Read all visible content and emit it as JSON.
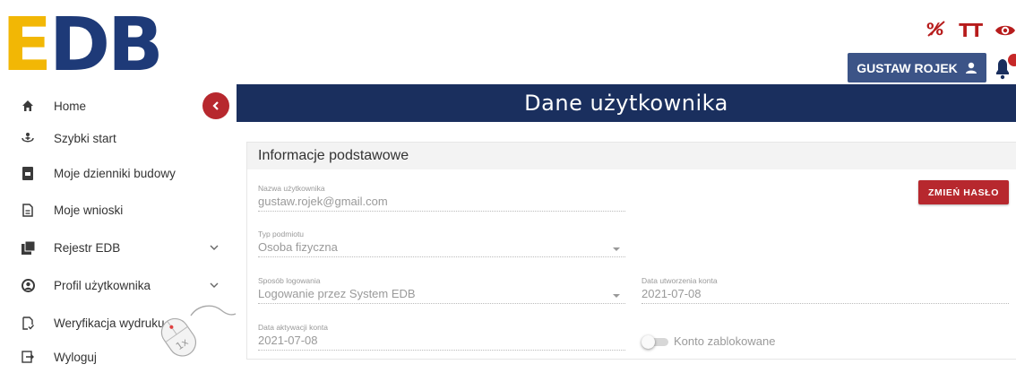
{
  "header": {
    "logo": {
      "e": "E",
      "db": "DB"
    },
    "tools": {
      "contrast_icon": "percent-slash-icon",
      "font_size_label": "TT",
      "eye_icon": "eye-icon"
    },
    "user_button_label": "GUSTAW ROJEK",
    "bell_badge_color": "#c62828"
  },
  "sidebar": {
    "items": [
      {
        "label": "Home",
        "icon": "home-icon"
      },
      {
        "label": "Szybki start",
        "icon": "quick-start-icon"
      },
      {
        "label": "Moje dzienniki budowy",
        "icon": "book-icon"
      },
      {
        "label": "Moje wnioski",
        "icon": "document-icon"
      },
      {
        "label": "Rejestr EDB",
        "icon": "register-icon"
      },
      {
        "label": "Profil użytkownika",
        "icon": "user-circle-icon"
      },
      {
        "label": "Weryfikacja wydruku",
        "icon": "file-check-icon"
      },
      {
        "label": "Wyloguj",
        "icon": "logout-icon"
      }
    ]
  },
  "main": {
    "title": "Dane użytkownika",
    "panel_title": "Informacje podstawowe",
    "fields": {
      "username": {
        "label": "Nazwa użytkownika",
        "value": "gustaw.rojek@gmail.com"
      },
      "entity_type": {
        "label": "Typ podmiotu",
        "value": "Osoba fizyczna"
      },
      "login_method": {
        "label": "Sposób logowania",
        "value": "Logowanie przez System EDB"
      },
      "created_date": {
        "label": "Data utworzenia konta",
        "value": "2021-07-08"
      },
      "activated_date": {
        "label": "Data aktywacji konta",
        "value": "2021-07-08"
      }
    },
    "change_password_label": "ZMIEŃ HASŁO",
    "account_locked_label": "Konto zablokowane",
    "account_locked": false
  },
  "overlay": {
    "click_badge": "1x"
  },
  "colors": {
    "brand_yellow": "#f2b705",
    "brand_navy": "#1e3a78",
    "accent_red": "#b7282e",
    "title_bar": "#1a2f5e"
  }
}
